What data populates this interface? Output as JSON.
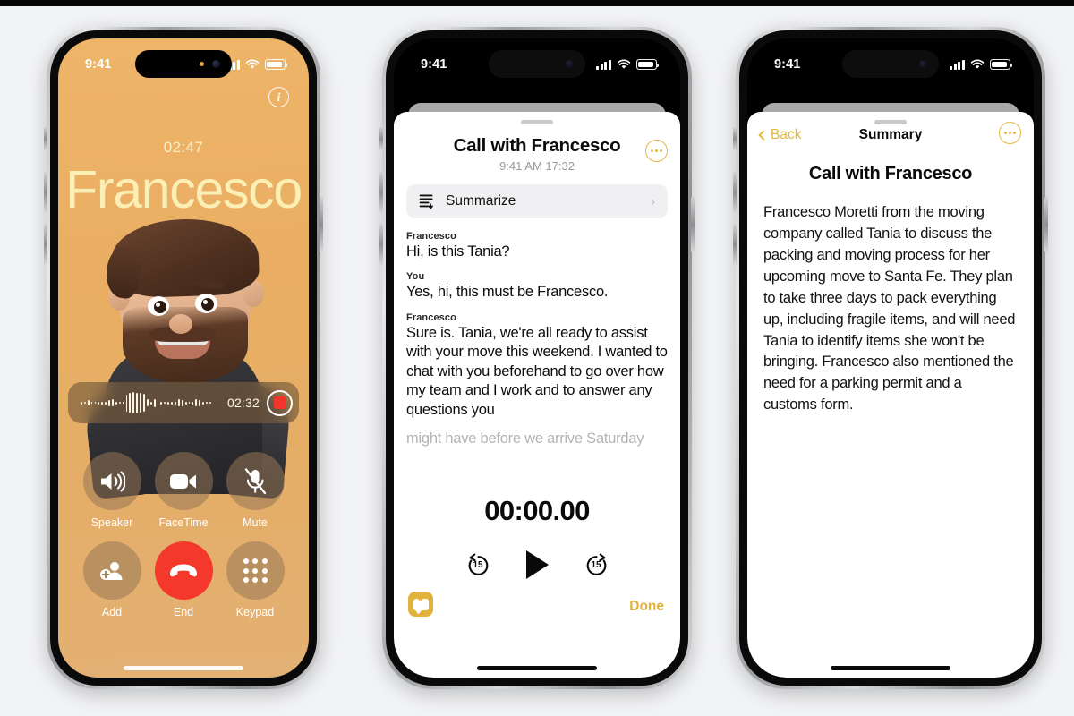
{
  "canvas": {
    "background": "#f2f3f5",
    "top_bar_color": "#050505"
  },
  "phone1": {
    "status_bar": {
      "time": "9:41",
      "signal": "cellular-bars",
      "wifi": "wifi-icon",
      "battery": "battery-full-icon"
    },
    "screen_name": "active-call",
    "background_color": "#e9ae63",
    "info_button": "i",
    "call_duration": "02:47",
    "caller_name": "Francesco",
    "recording_bar": {
      "elapsed": "02:32",
      "stop_button": "stop-record-button"
    },
    "controls": [
      {
        "label": "Speaker",
        "icon": "speaker-icon"
      },
      {
        "label": "FaceTime",
        "icon": "video-camera-icon"
      },
      {
        "label": "Mute",
        "icon": "microphone-muted-icon"
      },
      {
        "label": "Add",
        "icon": "add-person-icon"
      },
      {
        "label": "End",
        "icon": "end-call-icon",
        "color": "#f5382c"
      },
      {
        "label": "Keypad",
        "icon": "keypad-icon"
      }
    ]
  },
  "phone2": {
    "status_bar": {
      "time": "9:41",
      "signal": "cellular-bars",
      "wifi": "wifi-icon",
      "battery": "battery-full-icon"
    },
    "screen_name": "call-recording-transcript",
    "title": "Call with Francesco",
    "subtitle": "9:41 AM  17:32",
    "more_button": "more-options-icon",
    "summarize": {
      "label": "Summarize",
      "icon": "summarize-icon",
      "chevron": "chevron-right-icon"
    },
    "transcript": [
      {
        "speaker": "Francesco",
        "text": "Hi, is this Tania?",
        "faded": false
      },
      {
        "speaker": "You",
        "text": "Yes, hi, this must be Francesco.",
        "faded": false
      },
      {
        "speaker": "Francesco",
        "text": "Sure is. Tania, we're all ready to assist with your move this weekend. I wanted to chat with you beforehand to go over how my team and I work and to answer any questions you",
        "faded": false
      },
      {
        "speaker": "",
        "text": "might have before we arrive Saturday",
        "faded": true
      }
    ],
    "player": {
      "time": "00:00.00",
      "skip_back": "15",
      "skip_forward": "15",
      "play_button": "play-icon"
    },
    "quote_button": "transcription-icon",
    "done_label": "Done"
  },
  "phone3": {
    "status_bar": {
      "time": "9:41",
      "signal": "cellular-bars",
      "wifi": "wifi-icon",
      "battery": "battery-full-icon"
    },
    "screen_name": "call-summary",
    "nav": {
      "back_label": "Back",
      "title": "Summary",
      "more_button": "more-options-icon"
    },
    "heading": "Call with Francesco",
    "body": "Francesco Moretti from the moving company called Tania to discuss the packing and moving process for her upcoming move to Santa Fe. They plan to take three days to pack everything up, including fragile items, and will need Tania to identify items she won't be bringing. Francesco also mentioned the need for a parking permit and a customs form."
  },
  "colors": {
    "accent_gold": "#e2b83f",
    "call_orange": "#e9ae63",
    "end_red": "#f5382c",
    "name_cream": "#fcefb5"
  }
}
